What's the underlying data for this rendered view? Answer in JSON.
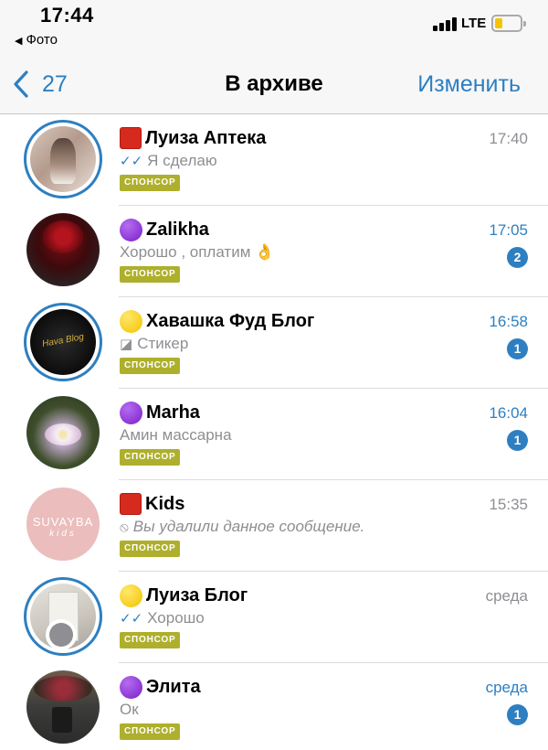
{
  "status_bar": {
    "time": "17:44",
    "back_app": "Фото",
    "network": "LTE"
  },
  "nav": {
    "back_count": "27",
    "title": "В архиве",
    "edit": "Изменить"
  },
  "chats": [
    {
      "emoji": "red-square",
      "name": "Луиза Аптека",
      "message": "Я сделаю",
      "read_check": true,
      "time": "17:40",
      "time_highlight": false,
      "unread": "",
      "badge": "СПОНСОР"
    },
    {
      "emoji": "purple-circle",
      "name": "Zalikha",
      "message": "Хорошо , оплатим 👌",
      "time": "17:05",
      "time_highlight": true,
      "unread": "2",
      "badge": "СПОНСОР"
    },
    {
      "emoji": "yellow-circle",
      "name": "Хавашка Фуд Блог",
      "message": "Стикер",
      "sticker": true,
      "time": "16:58",
      "time_highlight": true,
      "unread": "1",
      "badge": "СПОНСОР"
    },
    {
      "emoji": "purple-circle",
      "name": "Marha",
      "message": "Амин массарна",
      "time": "16:04",
      "time_highlight": true,
      "unread": "1",
      "badge": "СПОНСОР"
    },
    {
      "emoji": "red-square",
      "name": "Kids",
      "message": "Вы удалили данное сообщение.",
      "deleted": true,
      "time": "15:35",
      "time_highlight": false,
      "unread": "",
      "badge": "СПОНСОР",
      "avatar_text": "SUVAYBA",
      "avatar_subtext": "kids"
    },
    {
      "emoji": "yellow-circle",
      "name": "Луиза Блог",
      "message": "Хорошо",
      "read_check": true,
      "time": "среда",
      "time_highlight": false,
      "unread": "",
      "badge": "СПОНСОР"
    },
    {
      "emoji": "purple-circle",
      "name": "Элита",
      "message": "Ок",
      "time": "среда",
      "time_highlight": true,
      "unread": "1",
      "badge": "СПОНСОР"
    }
  ],
  "colors": {
    "accent": "#2d7fc1",
    "sponsor_badge": "#aeaf2c",
    "secondary_text": "#8e8e93"
  }
}
